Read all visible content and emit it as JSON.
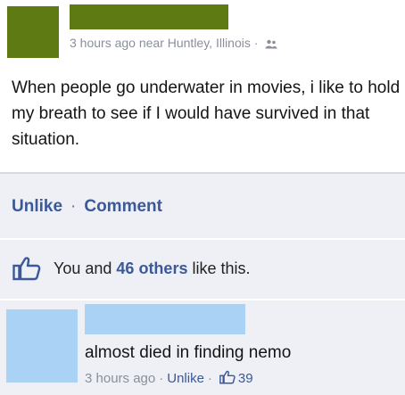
{
  "post": {
    "meta_time": "3 hours ago near Huntley, Illinois",
    "meta_sep": "·",
    "audience_icon": "people-icon",
    "text": "When people go underwater in movies, i like to hold my breath to see if I would have survived in that situation."
  },
  "actions": {
    "unlike_label": "Unlike",
    "sep": "·",
    "comment_label": "Comment"
  },
  "likes": {
    "icon": "thumbs-up-icon",
    "prefix": "You and ",
    "others_link": "46 others",
    "suffix": " like this."
  },
  "comment": {
    "text": "almost died in finding nemo",
    "time": "3 hours ago",
    "sep": "·",
    "unlike_label": "Unlike",
    "sep2": "·",
    "like_count": "39"
  },
  "colors": {
    "redaction_green": "#5d7b12",
    "redaction_blue": "#a9d2f5",
    "link_blue": "#3b5998",
    "panel_bg": "#eef0f5"
  }
}
